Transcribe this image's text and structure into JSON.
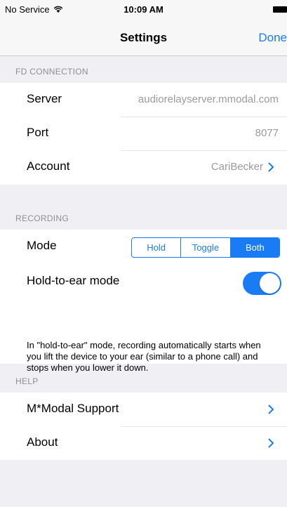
{
  "status_bar": {
    "carrier": "No Service",
    "time": "10:09 AM",
    "wifi_icon": "wifi-icon",
    "battery_icon": "battery-icon"
  },
  "nav": {
    "title": "Settings",
    "done_label": "Done"
  },
  "sections": {
    "connection": {
      "header": "FD CONNECTION",
      "rows": [
        {
          "label": "Server",
          "value": "audiorelayserver.mmodal.com"
        },
        {
          "label": "Port",
          "value": "8077"
        },
        {
          "label": "Account",
          "value": "CariBecker"
        }
      ]
    },
    "recording": {
      "header": "RECORDING",
      "mode_label": "Mode",
      "mode_options": [
        "Hold",
        "Toggle",
        "Both"
      ],
      "mode_selected": "Both",
      "hold_to_ear_label": "Hold-to-ear mode",
      "hold_to_ear_enabled": true,
      "footnote": "In \"hold-to-ear\" mode, recording automatically starts when you lift the device to your ear (similar to a phone call) and stops when you lower it down."
    },
    "help": {
      "header": "HELP",
      "rows": [
        {
          "label": "M*Modal Support"
        },
        {
          "label": "About"
        }
      ]
    }
  },
  "colors": {
    "accent": "#1a7cf5",
    "background": "#efeff4",
    "secondary_text": "#9b9b9f"
  }
}
